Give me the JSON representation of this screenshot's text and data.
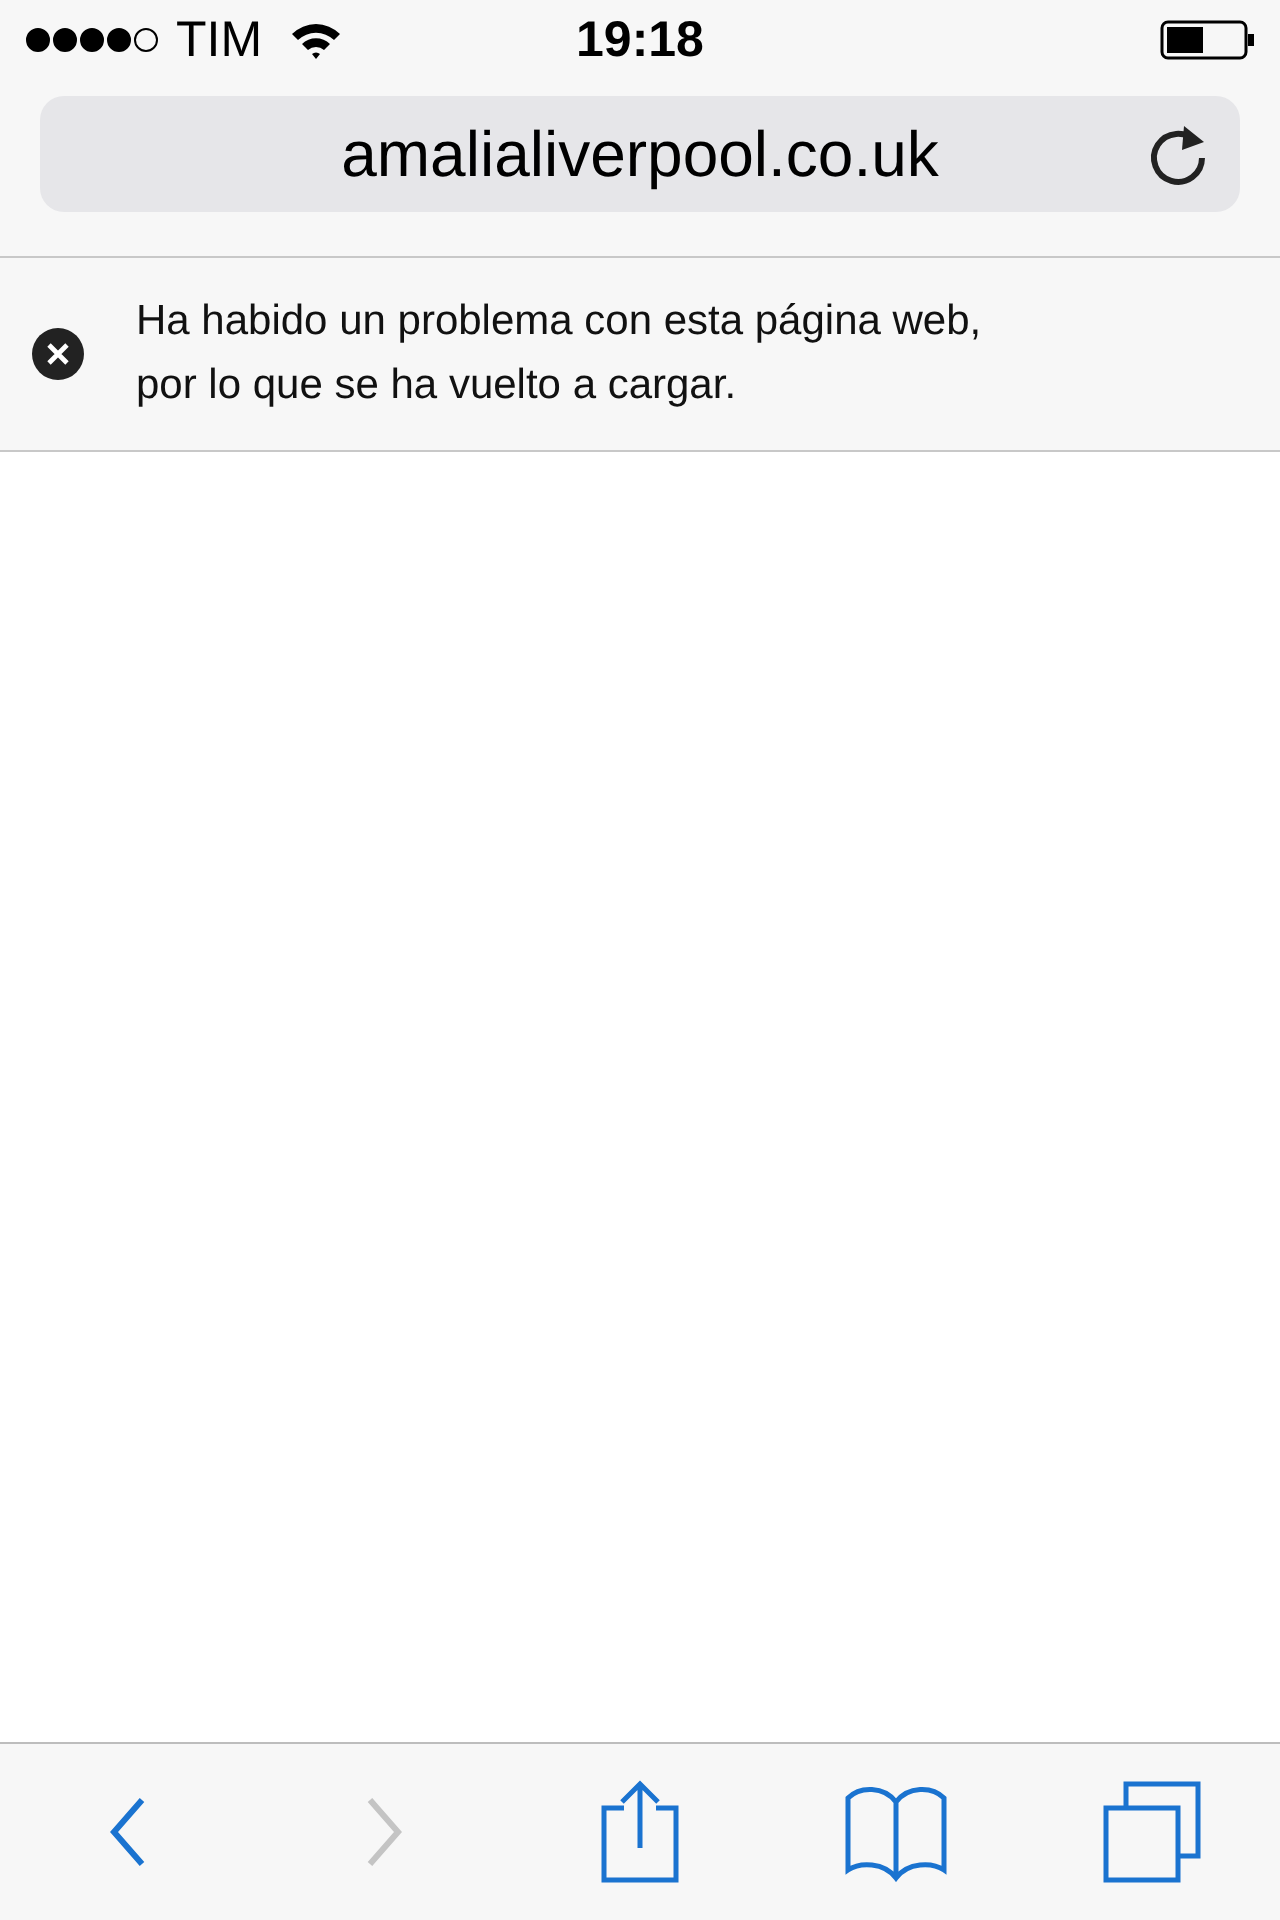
{
  "status_bar": {
    "carrier": "TIM",
    "time": "19:18"
  },
  "address_bar": {
    "url": "amalialiverpool.co.uk"
  },
  "notice": {
    "message": "Ha habido un problema con esta página web, por lo que se ha vuelto a cargar."
  },
  "toolbar": [
    {
      "kind": "back",
      "disabled": false
    },
    {
      "kind": "forward",
      "disabled": true
    },
    {
      "kind": "share",
      "disabled": false
    },
    {
      "kind": "bookmarks",
      "disabled": false
    },
    {
      "kind": "tabs",
      "disabled": false
    }
  ]
}
